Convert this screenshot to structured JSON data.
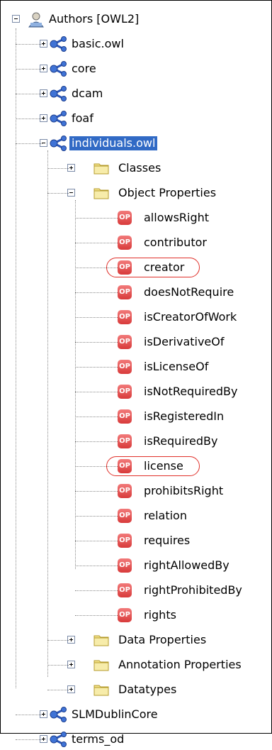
{
  "tree": {
    "root": {
      "label": "Authors [OWL2]",
      "icon": "authors-icon"
    },
    "ontologies_top": [
      {
        "label": "basic.owl",
        "expanded": false
      },
      {
        "label": "core",
        "expanded": false
      },
      {
        "label": "dcam",
        "expanded": false
      },
      {
        "label": "foaf",
        "expanded": false
      },
      {
        "label": "individuals.owl",
        "expanded": true,
        "selected": true
      }
    ],
    "individuals_children": {
      "classes": {
        "label": "Classes",
        "expanded": false
      },
      "object_properties": {
        "label": "Object Properties",
        "expanded": true,
        "badge": "OP",
        "items": [
          "allowsRight",
          "contributor",
          "creator",
          "doesNotRequire",
          "isCreatorOfWork",
          "isDerivativeOf",
          "isLicenseOf",
          "isNotRequiredBy",
          "isRegisteredIn",
          "isRequiredBy",
          "license",
          "prohibitsRight",
          "relation",
          "requires",
          "rightAllowedBy",
          "rightProhibitedBy",
          "rights"
        ],
        "highlighted": [
          "creator",
          "license"
        ]
      },
      "data_properties": {
        "label": "Data Properties",
        "expanded": false
      },
      "annotation_properties": {
        "label": "Annotation Properties",
        "expanded": false
      },
      "datatypes": {
        "label": "Datatypes",
        "expanded": false
      }
    },
    "ontologies_bottom": [
      {
        "label": "SLMDublinCore",
        "expanded": false
      },
      {
        "label": "terms_od",
        "expanded": false
      }
    ]
  },
  "colors": {
    "selection": "#316ac5",
    "highlight_circle": "#e0302a",
    "op_badge": "#d83a3a",
    "folder": "#f2e28a"
  }
}
